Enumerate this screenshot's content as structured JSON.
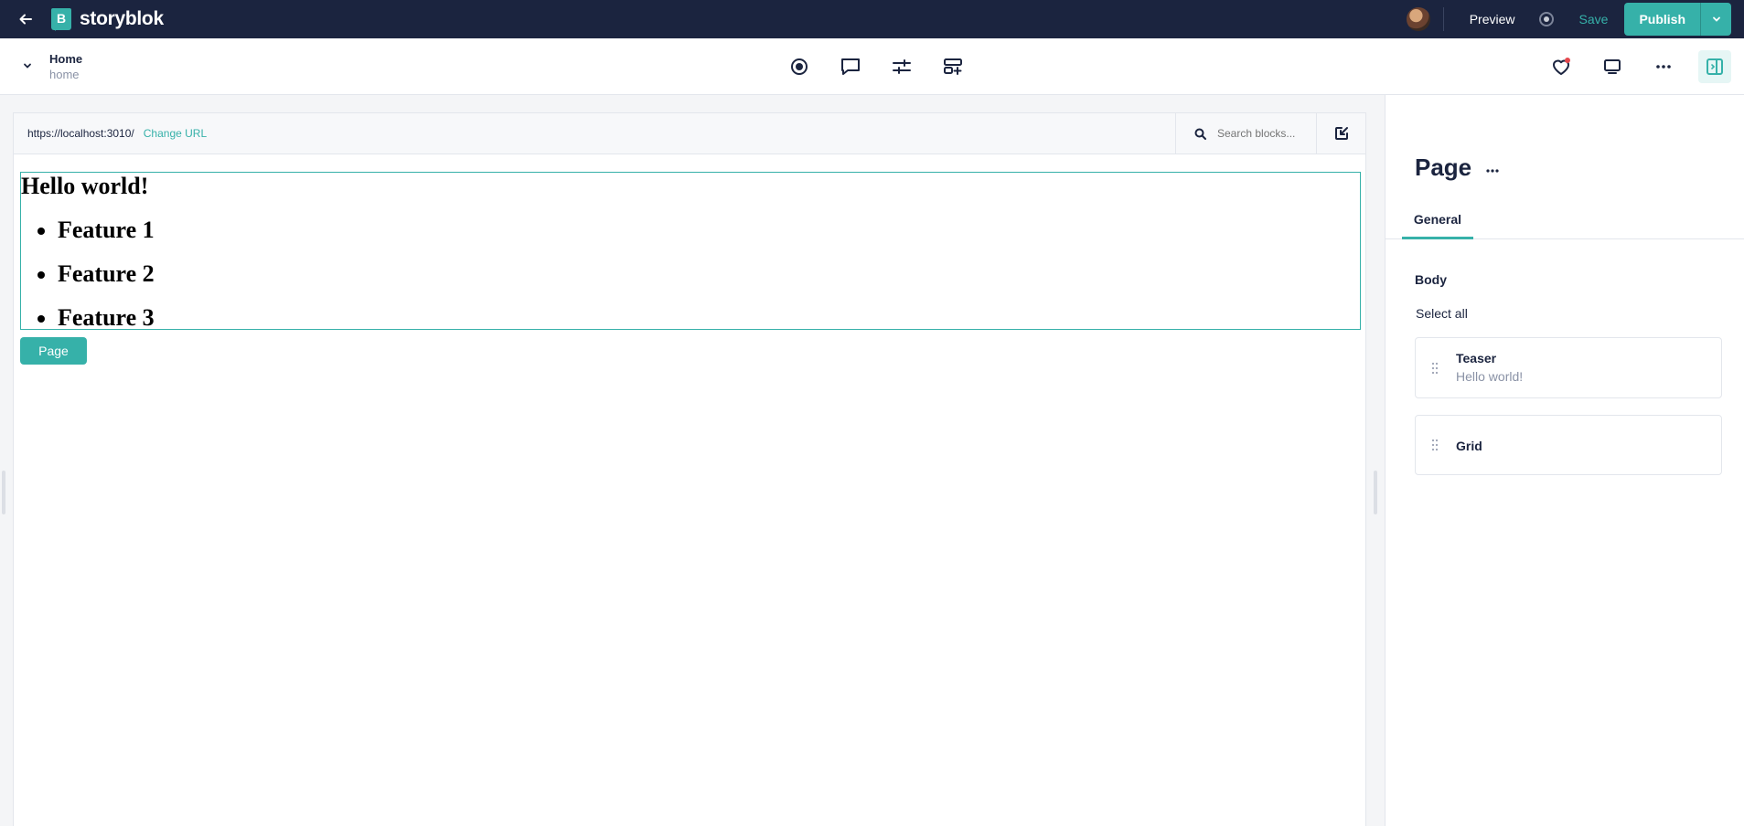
{
  "topbar": {
    "brand": "storyblok",
    "preview_label": "Preview",
    "save_label": "Save",
    "publish_label": "Publish"
  },
  "story": {
    "name": "Home",
    "slug": "home"
  },
  "preview": {
    "url": "https://localhost:3010/",
    "change_url_label": "Change URL",
    "search_placeholder": "Search blocks...",
    "heading": "Hello world!",
    "features": [
      "Feature 1",
      "Feature 2",
      "Feature 3"
    ],
    "page_tag": "Page"
  },
  "panel": {
    "title": "Page",
    "more": "···",
    "tab_general": "General",
    "field_label": "Body",
    "select_all": "Select all",
    "blocks": [
      {
        "name": "Teaser",
        "subtitle": "Hello world!"
      },
      {
        "name": "Grid",
        "subtitle": ""
      }
    ]
  },
  "colors": {
    "topbar_bg": "#1b243f",
    "accent": "#36b1a9",
    "notification_dot": "#e5484d"
  }
}
